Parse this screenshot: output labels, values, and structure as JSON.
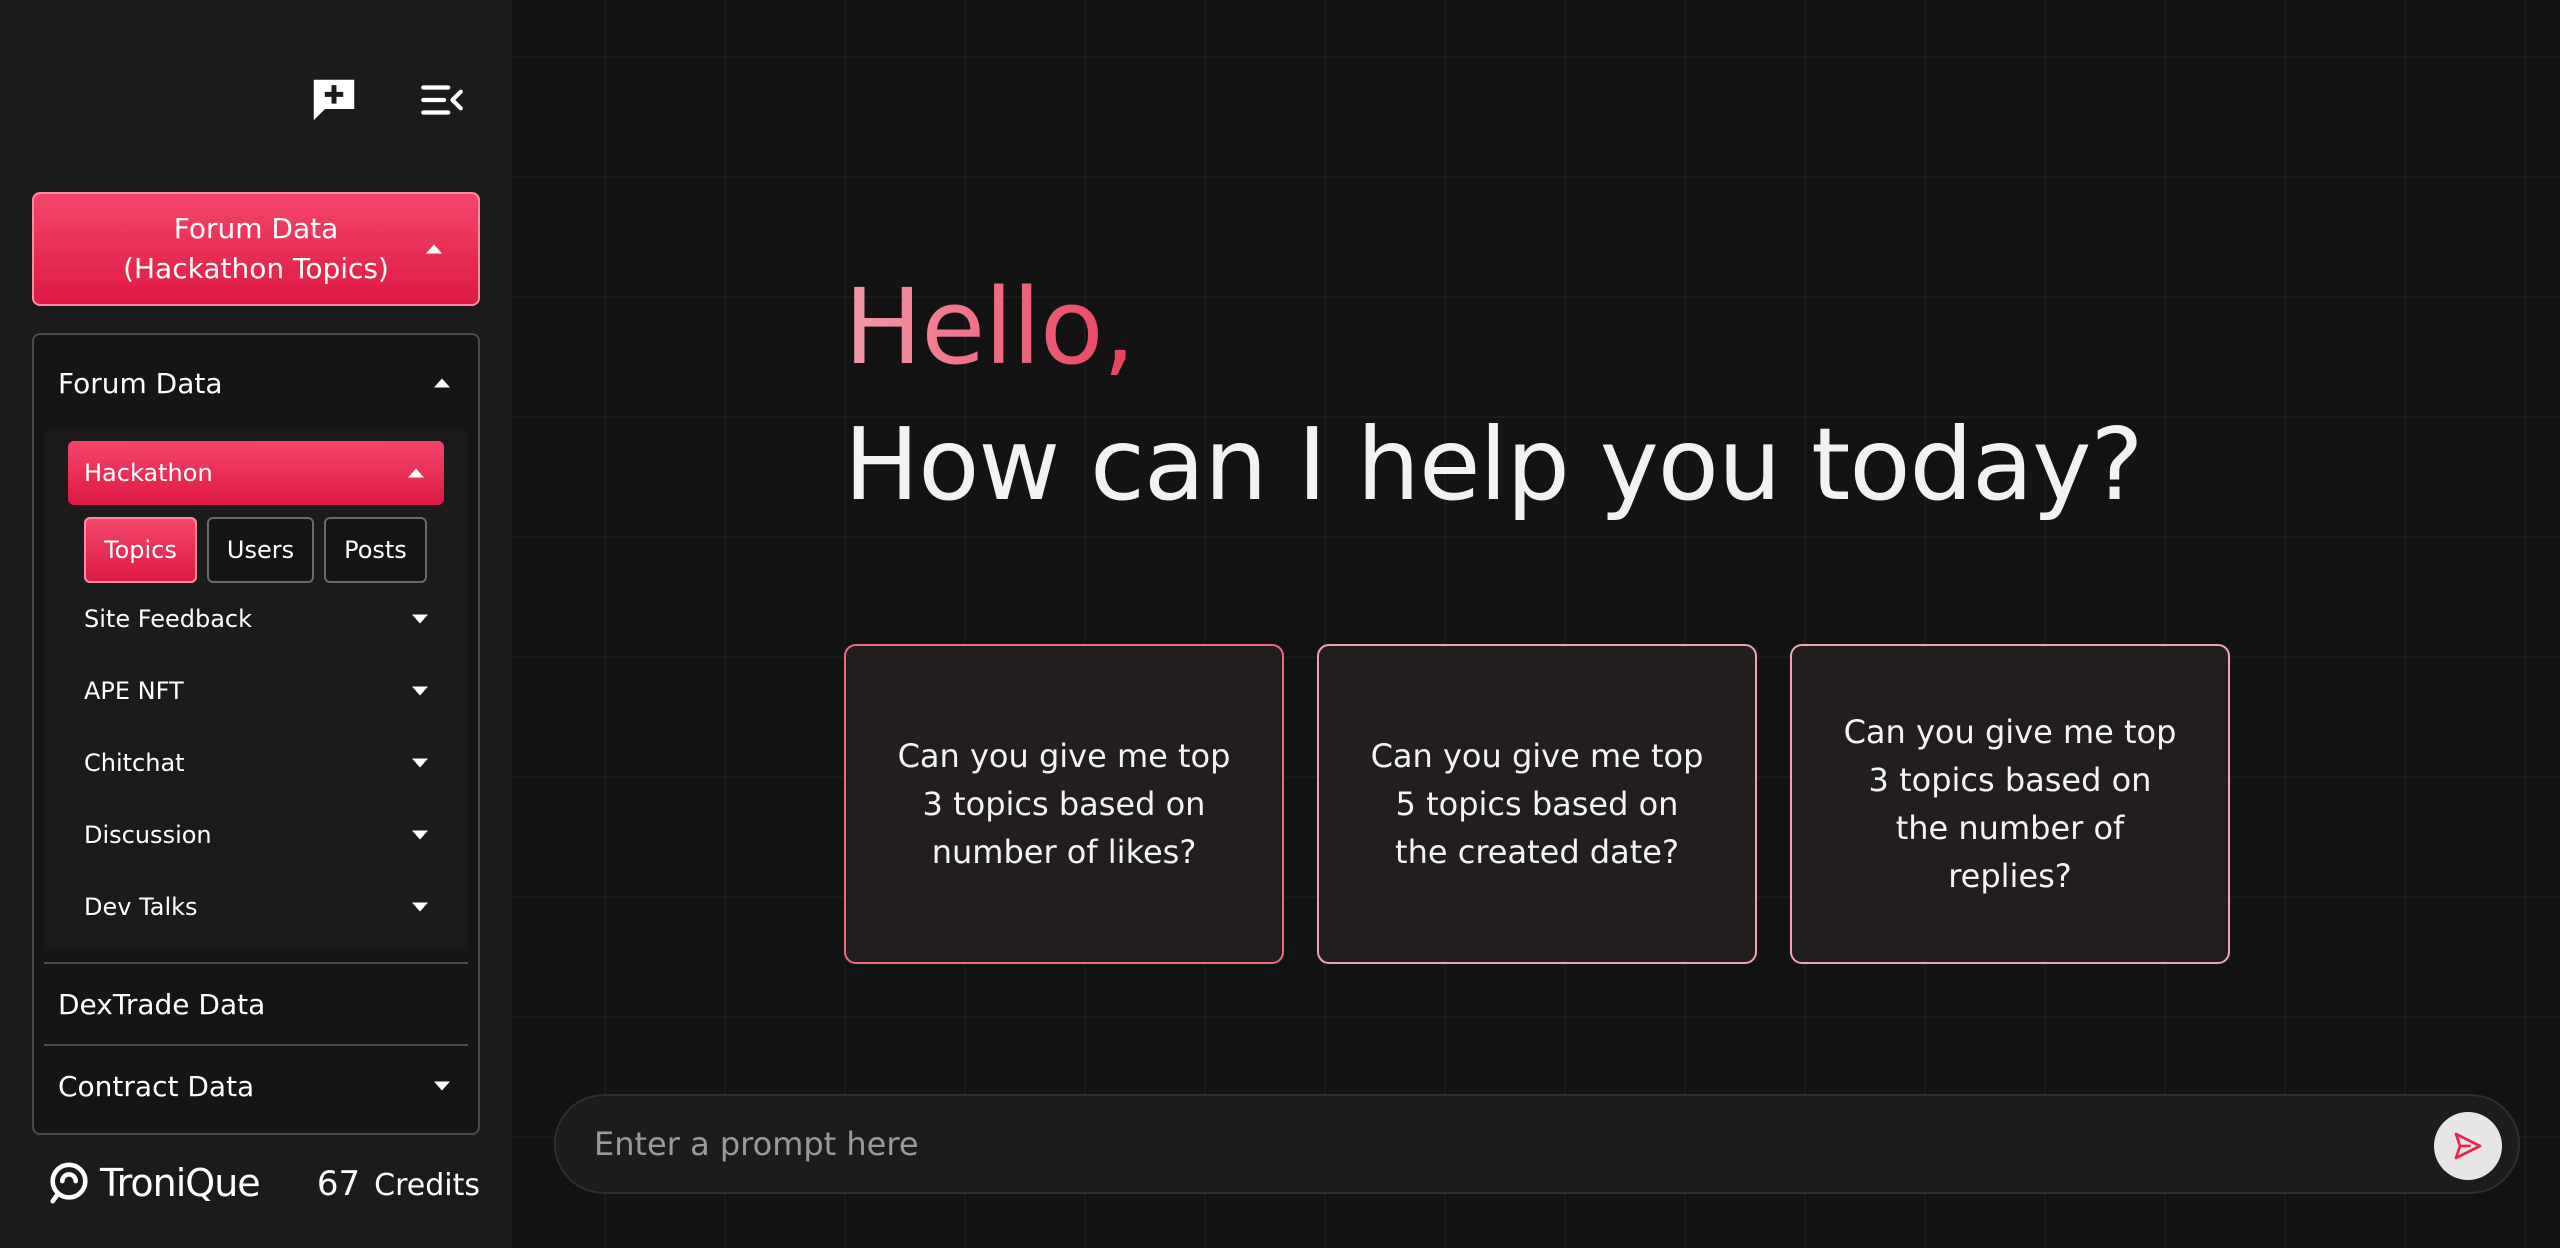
{
  "sidebar": {
    "database_selector": {
      "label": "Forum Data (Hackathon Topics)"
    },
    "tree": {
      "header": "Forum Data",
      "active_category": "Hackathon",
      "chips": [
        "Topics",
        "Users",
        "Posts"
      ],
      "active_chip": "Topics",
      "categories": [
        "Site Feedback",
        "APE NFT",
        "Chitchat",
        "Discussion",
        "Dev Talks"
      ],
      "sections": [
        "DexTrade Data",
        "Contract Data"
      ]
    },
    "brand": {
      "name": "TroniQue"
    },
    "credits": {
      "value": "67",
      "label": "Credits"
    }
  },
  "main": {
    "greeting": "Hello,",
    "headline": "How can I help you today?",
    "suggestions": [
      "Can you give me top 3 topics based on number of likes?",
      "Can you give me top 5 topics based on the created date?",
      "Can you give me top 3 topics based on the number of replies?"
    ],
    "prompt": {
      "placeholder": "Enter a prompt here",
      "value": ""
    }
  },
  "colors": {
    "accent": "#e8234d",
    "accent_light": "#f4466a",
    "background": "#131313",
    "sidebar": "#1b1b1b"
  },
  "icons": [
    "new-chat-icon",
    "collapse-sidebar-icon",
    "caret-up-icon",
    "caret-down-icon",
    "brand-logo-icon",
    "send-icon"
  ]
}
